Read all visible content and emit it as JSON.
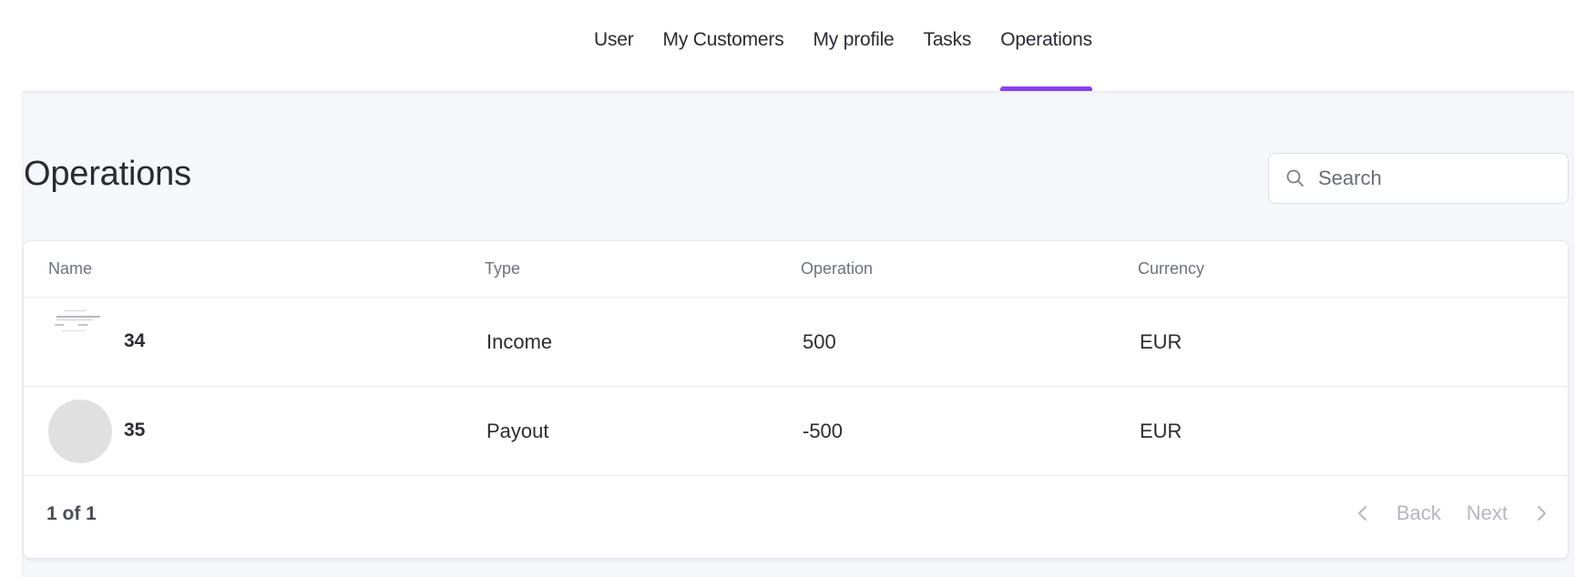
{
  "nav": {
    "items": [
      {
        "label": "User",
        "active": false
      },
      {
        "label": "My Customers",
        "active": false
      },
      {
        "label": "My profile",
        "active": false
      },
      {
        "label": "Tasks",
        "active": false
      },
      {
        "label": "Operations",
        "active": true
      }
    ],
    "accent_color": "#8b3ff0"
  },
  "page": {
    "title": "Operations"
  },
  "search": {
    "placeholder": "Search",
    "value": ""
  },
  "table": {
    "headers": {
      "name": "Name",
      "type": "Type",
      "operation": "Operation",
      "currency": "Currency"
    },
    "rows": [
      {
        "name": "34",
        "type": "Income",
        "operation": "500",
        "currency": "EUR",
        "avatar": "thumbnail"
      },
      {
        "name": "35",
        "type": "Payout",
        "operation": "-500",
        "currency": "EUR",
        "avatar": "placeholder"
      }
    ]
  },
  "pagination": {
    "summary": "1 of 1",
    "back_label": "Back",
    "next_label": "Next"
  },
  "icons": {
    "search": "search-icon",
    "prev": "chevron-left-icon",
    "next": "chevron-right-icon"
  }
}
